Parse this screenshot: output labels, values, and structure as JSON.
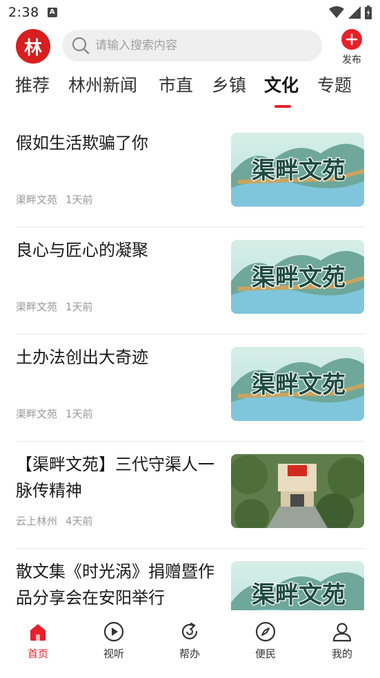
{
  "status_bar": {
    "time": "2:38",
    "notification_glyph": "A"
  },
  "header": {
    "logo_text": "林",
    "search_placeholder": "请输入搜索内容",
    "publish_label": "发布"
  },
  "tabs": [
    {
      "label": "推荐"
    },
    {
      "label": "林州新闻"
    },
    {
      "label": "市直"
    },
    {
      "label": "乡镇"
    },
    {
      "label": "文化",
      "active": true
    },
    {
      "label": "专题"
    }
  ],
  "feed": [
    {
      "title": "假如生活欺骗了你",
      "source": "渠畔文苑",
      "time": "1天前",
      "thumb_text": "渠畔文苑",
      "thumb_kind": "banner"
    },
    {
      "title": "良心与匠心的凝聚",
      "source": "渠畔文苑",
      "time": "1天前",
      "thumb_text": "渠畔文苑",
      "thumb_kind": "banner"
    },
    {
      "title": "土办法创出大奇迹",
      "source": "渠畔文苑",
      "time": "1天前",
      "thumb_text": "渠畔文苑",
      "thumb_kind": "banner"
    },
    {
      "title": "【渠畔文苑】三代守渠人一脉传精神",
      "source": "云上林州",
      "time": "4天前",
      "thumb_text": "",
      "thumb_kind": "photo"
    },
    {
      "title": "散文集《时光涡》捐赠暨作品分享会在安阳举行",
      "source": "",
      "time": "",
      "thumb_text": "渠畔文苑",
      "thumb_kind": "banner"
    }
  ],
  "bottom_nav": [
    {
      "label": "首页",
      "icon": "home-icon",
      "active": true
    },
    {
      "label": "视听",
      "icon": "play-icon"
    },
    {
      "label": "帮办",
      "icon": "refresh-icon"
    },
    {
      "label": "便民",
      "icon": "compass-icon"
    },
    {
      "label": "我的",
      "icon": "user-icon"
    }
  ],
  "colors": {
    "accent": "#e8202a",
    "text": "#1a1a1a",
    "meta": "#999999"
  }
}
